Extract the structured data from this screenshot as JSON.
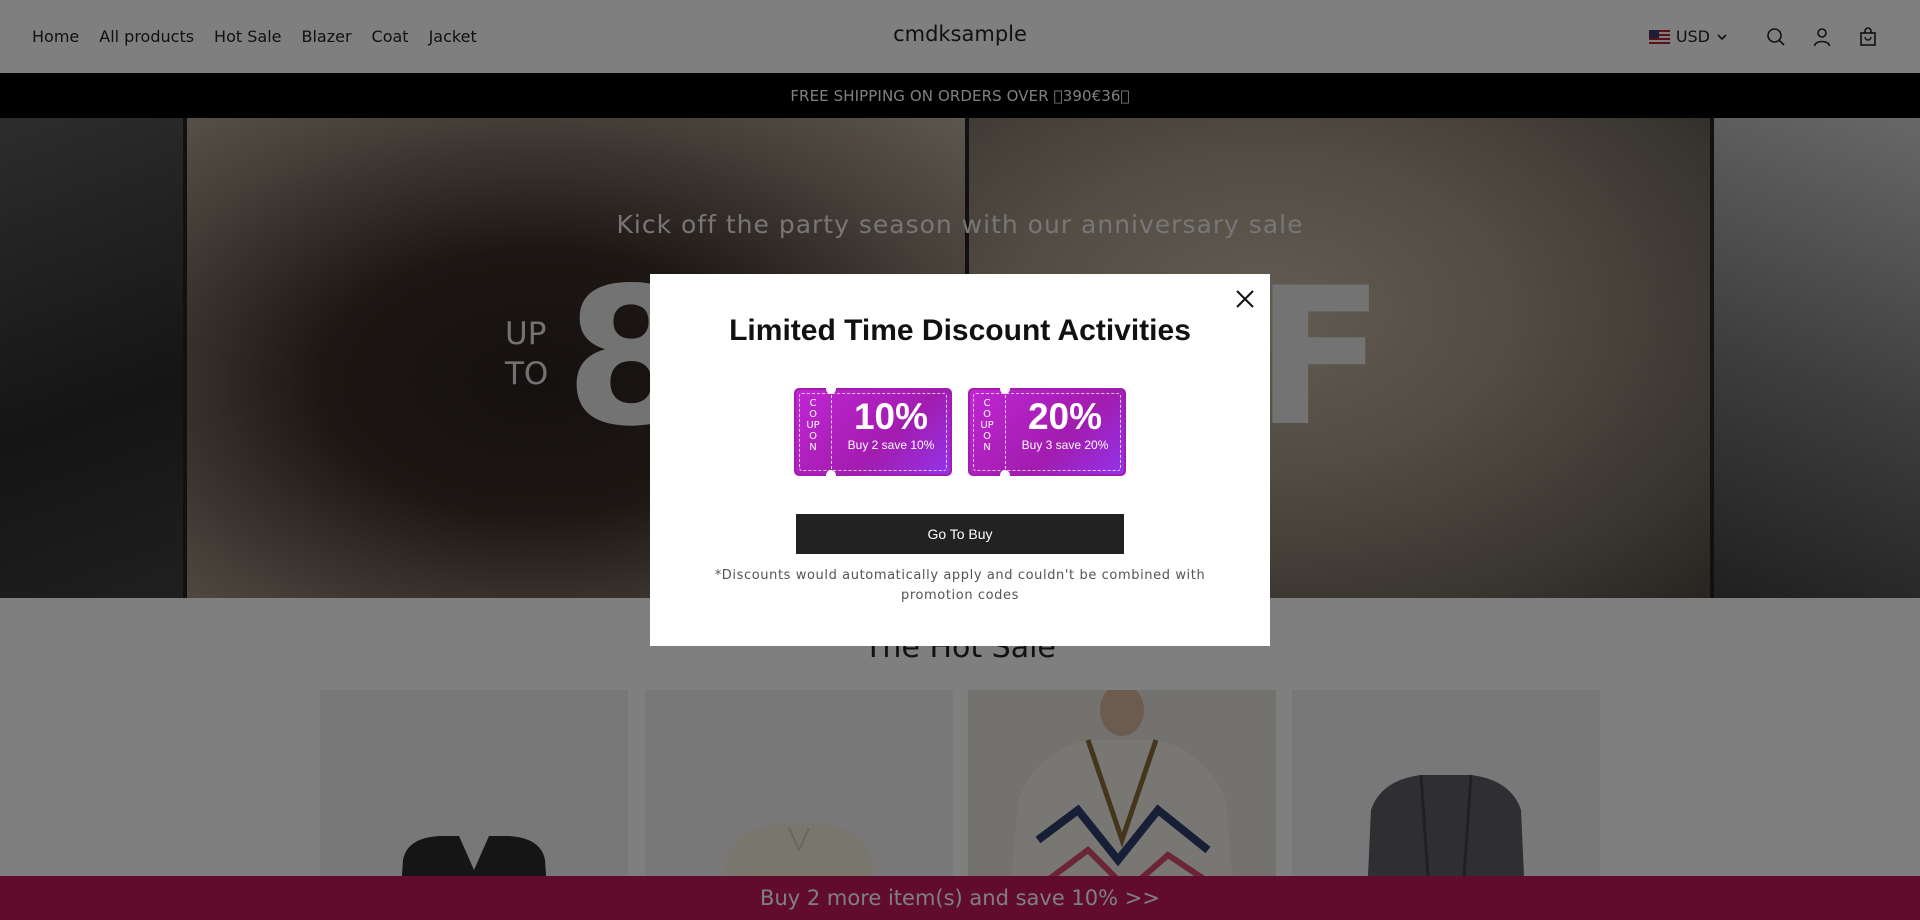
{
  "header": {
    "nav": [
      "Home",
      "All products",
      "Hot Sale",
      "Blazer",
      "Coat",
      "Jacket"
    ],
    "brand": "cmdksample",
    "currency": "USD",
    "icons": [
      "search-icon",
      "account-icon",
      "cart-icon"
    ]
  },
  "announcement": "FREE SHIPPING ON ORDERS OVER \u0000390€36\u0000",
  "hero": {
    "tagline": "Kick off the party season with our anniversary sale",
    "up_to_line1": "UP",
    "up_to_line2": "TO",
    "big_left": "8",
    "big_right": "F"
  },
  "section": {
    "title": "The Hot Sale"
  },
  "promo_bar": "Buy 2 more item(s) and save 10%  >>",
  "modal": {
    "title": "Limited Time Discount Activities",
    "coupons": [
      {
        "side": "COUPON",
        "percent": "10%",
        "desc": "Buy 2 save 10%"
      },
      {
        "side": "COUPON",
        "percent": "20%",
        "desc": "Buy 3 save 20%"
      }
    ],
    "button": "Go To Buy",
    "note": "*Discounts would automatically apply and couldn't be combined with promotion codes"
  },
  "colors": {
    "coupon": "#c026d3",
    "promo_bar": "#c2185b",
    "button": "#222222"
  }
}
